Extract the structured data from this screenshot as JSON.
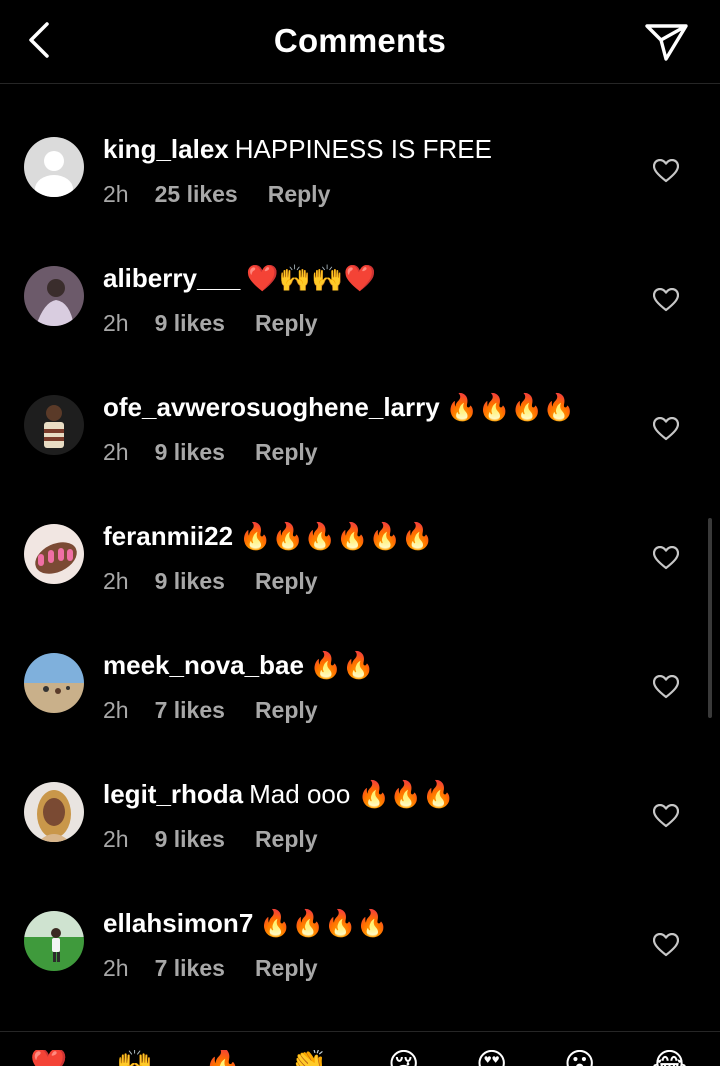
{
  "header": {
    "title": "Comments"
  },
  "comments": [
    {
      "user": "king_lalex",
      "text": "HAPPINESS IS FREE",
      "time": "2h",
      "likes": "25 likes",
      "reply": "Reply",
      "avatar": "default-avatar"
    },
    {
      "user": "aliberry___",
      "text": "❤️🙌🙌❤️",
      "time": "2h",
      "likes": "9 likes",
      "reply": "Reply",
      "avatar": "photo-avatar"
    },
    {
      "user": "ofe_avwerosuoghene_larry",
      "text": "🔥🔥🔥🔥",
      "time": "2h",
      "likes": "9 likes",
      "reply": "Reply",
      "avatar": "photo-avatar"
    },
    {
      "user": "feranmii22",
      "text": "🔥🔥🔥🔥🔥🔥",
      "time": "2h",
      "likes": "9 likes",
      "reply": "Reply",
      "avatar": "photo-avatar"
    },
    {
      "user": "meek_nova_bae",
      "text": "🔥🔥",
      "time": "2h",
      "likes": "7 likes",
      "reply": "Reply",
      "avatar": "photo-avatar"
    },
    {
      "user": "legit_rhoda",
      "text": "Mad ooo 🔥🔥🔥",
      "time": "2h",
      "likes": "9 likes",
      "reply": "Reply",
      "avatar": "photo-avatar"
    },
    {
      "user": "ellahsimon7",
      "text": "🔥🔥🔥🔥",
      "time": "2h",
      "likes": "7 likes",
      "reply": "Reply",
      "avatar": "photo-avatar"
    }
  ],
  "reactions": [
    "❤️",
    "🙌",
    "🔥",
    "👏",
    "😢",
    "😍",
    "😮",
    "😂"
  ]
}
